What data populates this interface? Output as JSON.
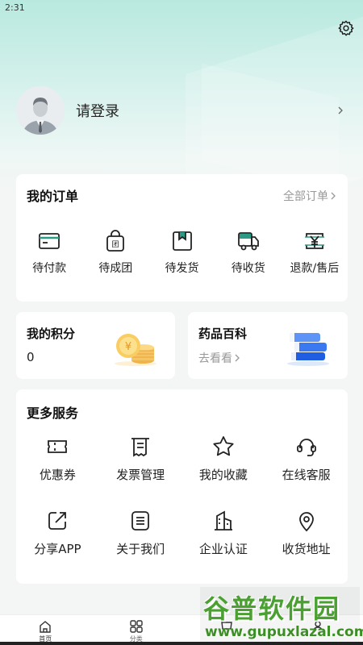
{
  "status": {
    "time": "2:31"
  },
  "profile": {
    "login_label": "请登录"
  },
  "orders": {
    "title": "我的订单",
    "all_label": "全部订单",
    "items": [
      {
        "label": "待付款",
        "icon": "wallet-card-icon"
      },
      {
        "label": "待成团",
        "icon": "group-bag-icon"
      },
      {
        "label": "待发货",
        "icon": "package-box-icon"
      },
      {
        "label": "待收货",
        "icon": "delivery-truck-icon"
      },
      {
        "label": "退款/售后",
        "icon": "refund-yen-icon"
      }
    ]
  },
  "points": {
    "title": "我的积分",
    "value": "0"
  },
  "baike": {
    "title": "药品百科",
    "link": "去看看"
  },
  "services": {
    "title": "更多服务",
    "items": [
      {
        "label": "优惠券",
        "icon": "coupon-icon"
      },
      {
        "label": "发票管理",
        "icon": "invoice-icon"
      },
      {
        "label": "我的收藏",
        "icon": "star-icon"
      },
      {
        "label": "在线客服",
        "icon": "headset-icon"
      },
      {
        "label": "分享APP",
        "icon": "share-icon"
      },
      {
        "label": "关于我们",
        "icon": "about-doc-icon"
      },
      {
        "label": "企业认证",
        "icon": "building-icon"
      },
      {
        "label": "收货地址",
        "icon": "location-pin-icon"
      }
    ]
  },
  "tabbar": {
    "items": [
      {
        "label": "首页",
        "icon": "home-icon"
      },
      {
        "label": "分类",
        "icon": "category-grid-icon"
      },
      {
        "label": "",
        "icon": "cart-icon"
      },
      {
        "label": "",
        "icon": "user-icon"
      }
    ]
  },
  "watermark": {
    "title": "谷普软件园",
    "url": "www.gupuxlazal.com"
  },
  "colors": {
    "accent_mint": "#b8e9df",
    "background": "#f4f6f5",
    "watermark_green": "#4aa030"
  }
}
